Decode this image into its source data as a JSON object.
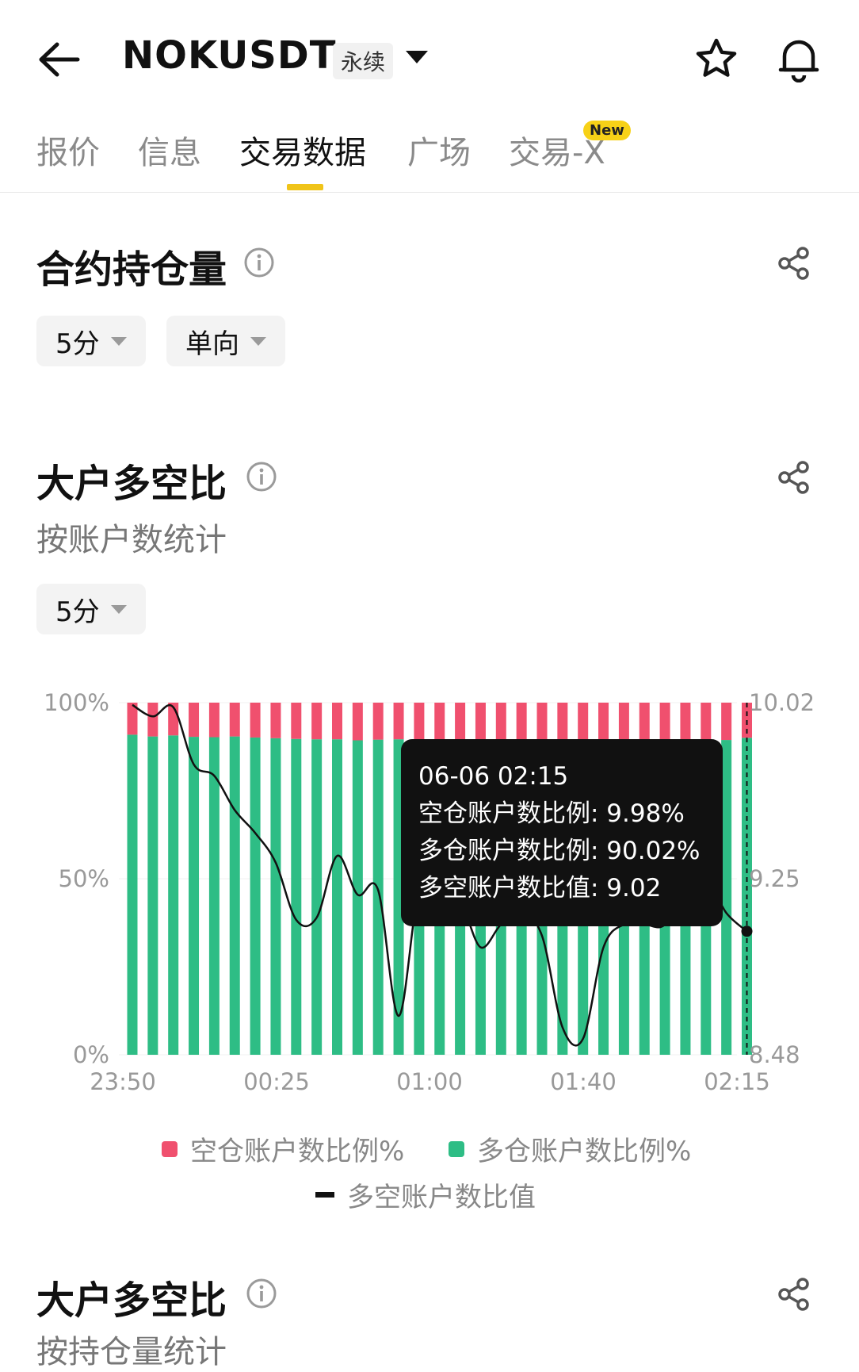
{
  "header": {
    "symbol": "NOKUSDT",
    "perp_badge": "永续",
    "icons": [
      "back-arrow-icon",
      "chevron-down-icon",
      "star-icon",
      "bell-icon"
    ]
  },
  "tabs": {
    "items": [
      {
        "label": "报价"
      },
      {
        "label": "信息"
      },
      {
        "label": "交易数据"
      },
      {
        "label": "广场"
      },
      {
        "label": "交易-X"
      }
    ],
    "active_index": 2,
    "new_badge": "New"
  },
  "open_interest": {
    "title": "合约持仓量",
    "interval": "5分",
    "mode": "单向"
  },
  "top_ratio": {
    "title": "大户多空比",
    "subtitle": "按账户数统计",
    "interval": "5分"
  },
  "top_ratio_2": {
    "title": "大户多空比",
    "subtitle": "按持仓量统计"
  },
  "tooltip": {
    "time": "06-06 02:15",
    "short_line": "空仓账户数比例: 9.98%",
    "long_line": "多仓账户数比例: 90.02%",
    "ratio_line": "多空账户数比值: 9.02"
  },
  "legend": {
    "short": "空仓账户数比例%",
    "long": "多仓账户数比例%",
    "ratio": "多空账户数比值"
  },
  "colors": {
    "short": "#f0506e",
    "long": "#2ebd85",
    "line": "#111111",
    "accent": "#f0c419"
  },
  "chart_data": {
    "type": "bar",
    "left_axis_ticks": [
      "100%",
      "50%",
      "0%"
    ],
    "right_axis_ticks": [
      "10.02",
      "9.25",
      "8.48"
    ],
    "x_tick_labels": [
      "23:50",
      "00:25",
      "01:00",
      "01:40",
      "02:15"
    ],
    "ylim_left": [
      0,
      100
    ],
    "ylim_right": [
      8.48,
      10.02
    ],
    "series": [
      {
        "name": "空仓账户数比例%",
        "values": [
          9.1,
          9.6,
          9.3,
          9.7,
          9.8,
          9.6,
          9.9,
          10.1,
          10.3,
          10.4,
          10.4,
          10.7,
          10.5,
          10.4,
          10.6,
          11.2,
          10.8,
          10.4,
          10.9,
          10.7,
          10.9,
          11.6,
          11.4,
          10.8,
          10.6,
          10.6,
          10.8,
          10.9,
          10.6,
          10.6,
          9.98
        ]
      },
      {
        "name": "多仓账户数比例%",
        "values": [
          90.9,
          90.4,
          90.7,
          90.3,
          90.2,
          90.4,
          90.1,
          89.9,
          89.7,
          89.6,
          89.6,
          89.3,
          89.5,
          89.6,
          89.4,
          88.8,
          89.2,
          89.6,
          89.1,
          89.3,
          89.1,
          88.4,
          88.6,
          89.2,
          89.4,
          89.4,
          89.2,
          89.1,
          89.4,
          89.4,
          90.02
        ]
      },
      {
        "name": "多空账户数比值",
        "values": [
          10.01,
          9.96,
          10.0,
          9.75,
          9.7,
          9.55,
          9.45,
          9.32,
          9.07,
          9.08,
          9.35,
          9.18,
          9.2,
          8.65,
          9.2,
          9.15,
          9.15,
          8.95,
          9.05,
          9.1,
          9.0,
          8.6,
          8.55,
          8.95,
          9.05,
          9.05,
          9.05,
          9.22,
          9.25,
          9.1,
          9.02
        ]
      }
    ],
    "highlight_index": 30
  }
}
